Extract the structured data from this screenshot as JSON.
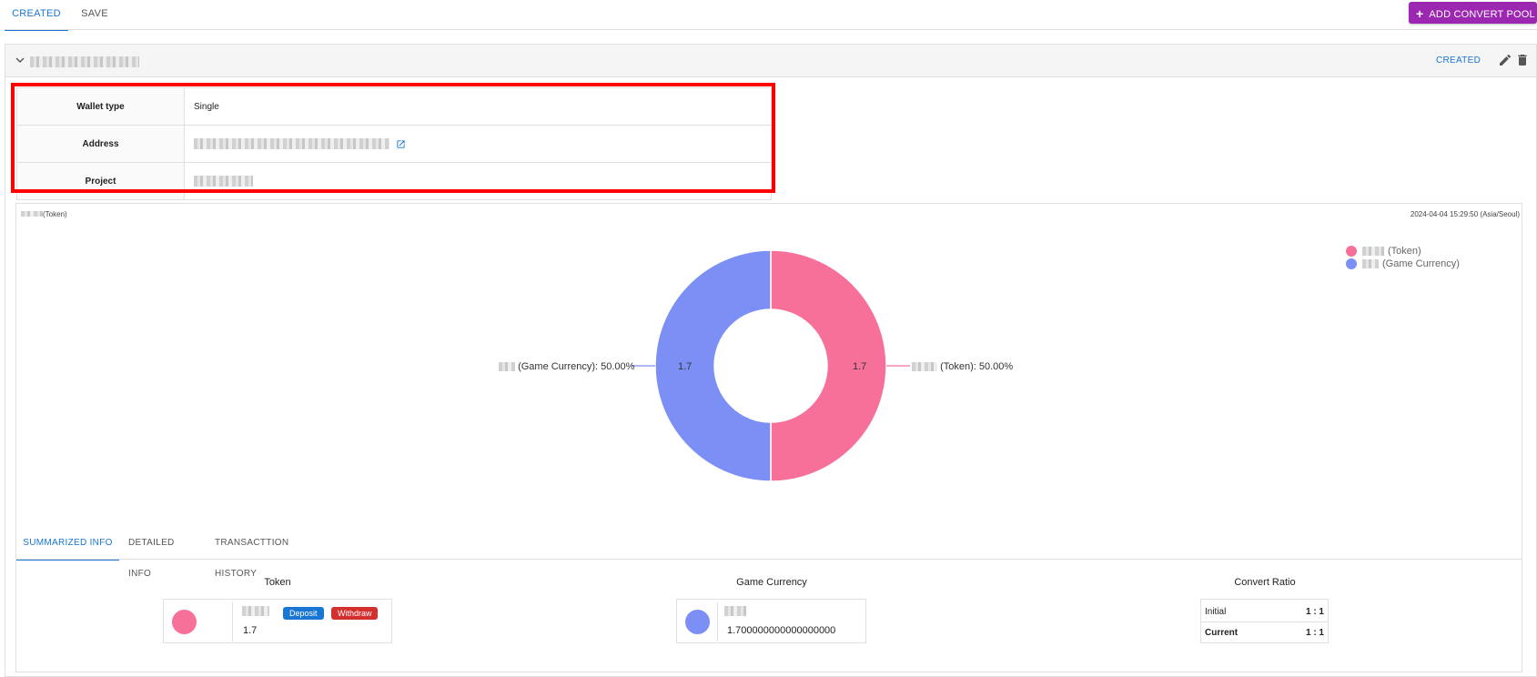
{
  "tabs": {
    "created": "CREATED",
    "save": "SAVE"
  },
  "add_button": {
    "label": "ADD CONVERT POOL",
    "color": "#9c27b0"
  },
  "pool": {
    "status": "CREATED"
  },
  "info": {
    "wallet_type_label": "Wallet type",
    "wallet_type_value": "Single",
    "address_label": "Address",
    "project_label": "Project"
  },
  "chart_header": {
    "title_suffix": "(Token)",
    "timestamp": "2024-04-04 15:29:50 (Asia/Seoul)"
  },
  "chart_data": {
    "type": "pie",
    "donut": true,
    "series": [
      {
        "name": "(Token)",
        "value": 1.7,
        "percent": "50.00%",
        "color": "#f67099",
        "label_text": "(Token): 50.00%"
      },
      {
        "name": "(Game Currency)",
        "value": 1.7,
        "percent": "50.00%",
        "color": "#7b8ff5",
        "label_text": "(Game Currency): 50.00%"
      }
    ],
    "value_labels": [
      "1.7",
      "1.7"
    ],
    "legend_position": "top-right"
  },
  "sub_tabs": {
    "summarized": "SUMMARIZED INFO",
    "detailed": "DETAILED INFO",
    "history": "TRANSACTTION HISTORY"
  },
  "summary": {
    "token_title": "Token",
    "token_amount": "1.7",
    "deposit_label": "Deposit",
    "withdraw_label": "Withdraw",
    "game_title": "Game Currency",
    "game_amount": "1.700000000000000000",
    "ratio_title": "Convert Ratio",
    "ratio_initial_label": "Initial",
    "ratio_initial_value": "1 : 1",
    "ratio_current_label": "Current",
    "ratio_current_value": "1 : 1"
  },
  "colors": {
    "accent": "#1976d2",
    "token": "#f67099",
    "game": "#7b8ff5",
    "deposit": "#1976d2",
    "withdraw": "#d32f2f",
    "highlight": "#ff0000"
  }
}
